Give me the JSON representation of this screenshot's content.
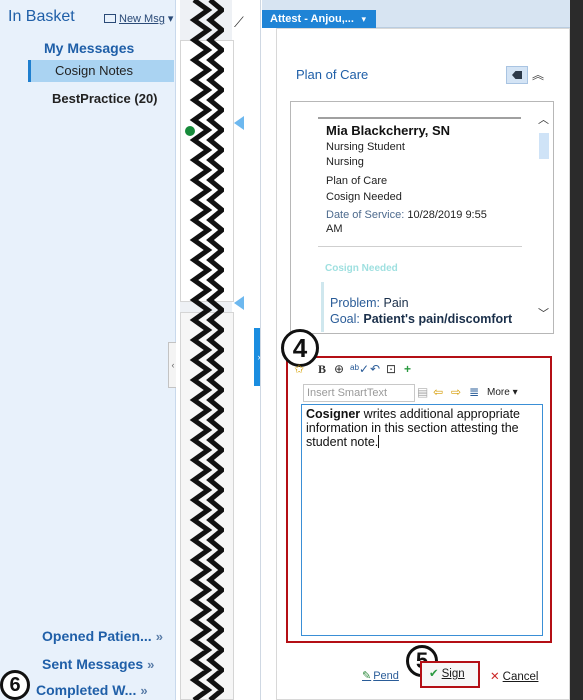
{
  "inbasket": {
    "title": "In Basket",
    "new_msg": "New Msg",
    "my_messages": "My Messages",
    "folders": [
      {
        "label": "Cosign Notes",
        "selected": true
      },
      {
        "label": "BestPractice (20)",
        "selected": false
      }
    ],
    "bottom_links": [
      {
        "label": "Opened Patien...",
        "chevron": "»"
      },
      {
        "label": "Sent Messages",
        "chevron": "»"
      },
      {
        "label": "Completed W...",
        "chevron": "»"
      }
    ]
  },
  "tab": {
    "label": "Attest - Anjou,...",
    "chevron": "▾"
  },
  "plan_of_care": {
    "title": "Plan of Care",
    "tag_icon": "tag-icon",
    "collapse_icon": "double-chevron-up-icon"
  },
  "note": {
    "name": "Mia Blackcherry, SN",
    "lines": [
      "Nursing Student",
      "Nursing",
      "Plan of Care",
      "Cosign Needed"
    ],
    "dos_label": "Date of Service:",
    "dos_value": "10/28/2019 9:55",
    "dos_time_suffix": "AM",
    "cosign_label": "Cosign Needed",
    "problem_label": "Problem:",
    "problem_value": "Pain",
    "goal_label": "Goal:",
    "goal_value": "Patient's pain/discomfort"
  },
  "editor": {
    "smarttext_placeholder": "Insert SmartText",
    "more_label": "More",
    "body_bold": "Cosigner",
    "body_text": " writes additional appropriate information in this section attesting the student note."
  },
  "footer": {
    "pend_label": "Pend",
    "sign_label": "Sign",
    "cancel_label": "Cancel"
  },
  "callouts": {
    "four": "4",
    "five": "5",
    "six": "6"
  },
  "colors": {
    "accent": "#1f84d6",
    "highlight_border": "#b40f15",
    "selected_folder": "#aad3f2"
  }
}
